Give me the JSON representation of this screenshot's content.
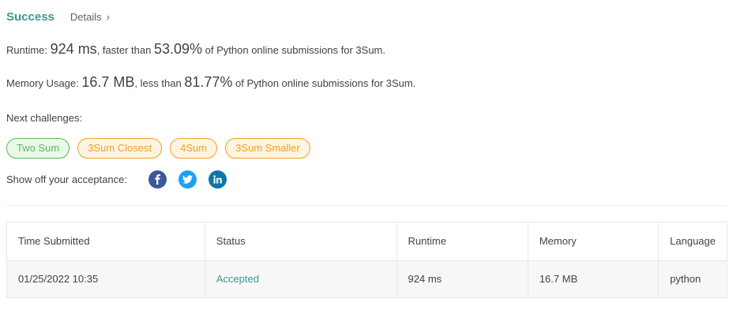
{
  "header": {
    "title": "Success",
    "details_label": "Details",
    "chevron": "›"
  },
  "runtime": {
    "label": "Runtime:",
    "value": "924 ms",
    "mid_text": ", faster than",
    "percent": "53.09%",
    "suffix": "of Python online submissions for 3Sum."
  },
  "memory": {
    "label": "Memory Usage:",
    "value": "16.7 MB",
    "mid_text": ", less than",
    "percent": "81.77%",
    "suffix": "of Python online submissions for 3Sum."
  },
  "next_challenges": {
    "label": "Next challenges:",
    "items": [
      {
        "label": "Two Sum",
        "difficulty": "easy"
      },
      {
        "label": "3Sum Closest",
        "difficulty": "medium"
      },
      {
        "label": "4Sum",
        "difficulty": "medium"
      },
      {
        "label": "3Sum Smaller",
        "difficulty": "medium"
      }
    ]
  },
  "share": {
    "label": "Show off your acceptance:",
    "icons": [
      "facebook-icon",
      "twitter-icon",
      "linkedin-icon"
    ]
  },
  "table": {
    "headers": [
      "Time Submitted",
      "Status",
      "Runtime",
      "Memory",
      "Language"
    ],
    "rows": [
      {
        "time_submitted": "01/25/2022 10:35",
        "status": "Accepted",
        "runtime": "924 ms",
        "memory": "16.7 MB",
        "language": "python"
      }
    ]
  },
  "colors": {
    "success": "#3c9a8f",
    "easy": "#5cb85c",
    "medium": "#f0a020",
    "facebook": "#3b5998",
    "twitter": "#1da1f2",
    "linkedin": "#0e76a8"
  }
}
